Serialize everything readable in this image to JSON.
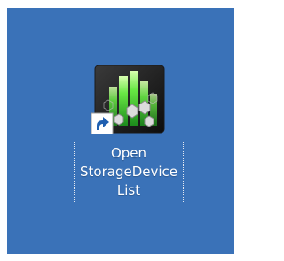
{
  "desktop": {
    "background_color": "#3a72b8",
    "shortcut": {
      "icon": "storage-device-list-icon",
      "overlay_icon": "shortcut-arrow-icon",
      "label_lines": [
        "Open",
        "StorageDevice",
        "List"
      ]
    }
  }
}
